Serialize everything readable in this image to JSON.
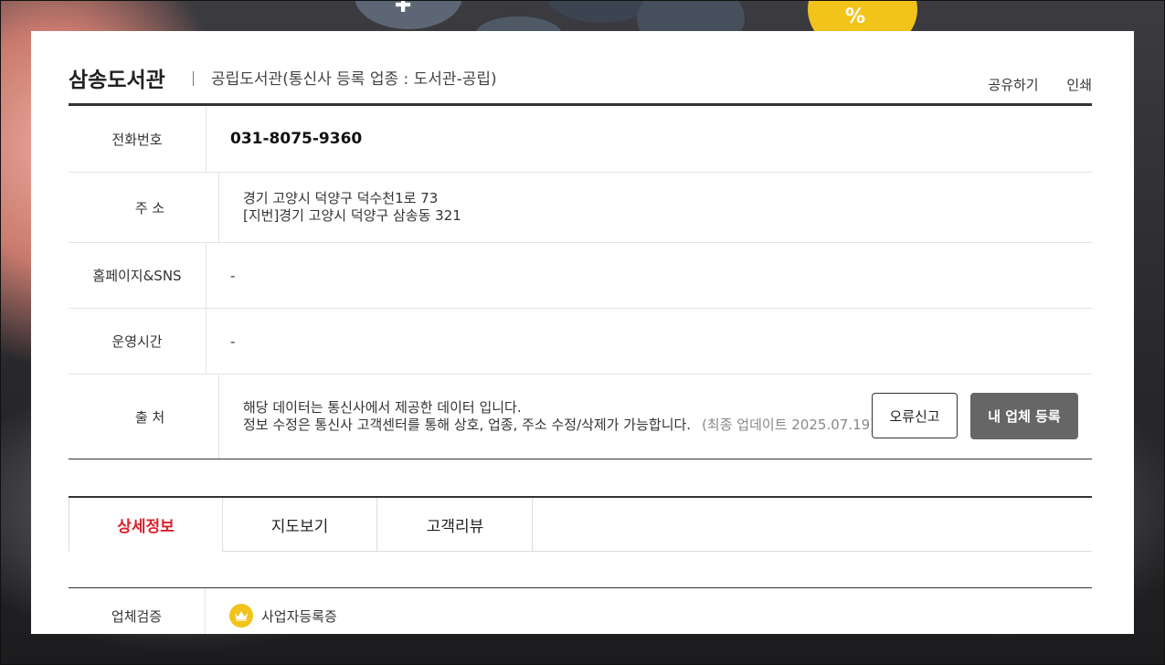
{
  "header": {
    "title": "삼송도서관",
    "subtitle": "공립도서관(통신사 등록 업종 : 도서관-공립)",
    "share_label": "공유하기",
    "print_label": "인쇄"
  },
  "info": {
    "phone_label": "전화번호",
    "phone_value": "031-8075-9360",
    "address_label": "주 소",
    "address_line1": "경기 고양시 덕양구 덕수천1로 73",
    "address_line2": "[지번]경기 고양시 덕양구 삼송동 321",
    "homepage_label": "홈페이지&SNS",
    "homepage_value": "-",
    "hours_label": "운영시간",
    "hours_value": "-",
    "source_label": "출 처",
    "source_line1": "해당 데이터는 통신사에서 제공한 데이터 입니다.",
    "source_line2": "정보 수정은 통신사 고객센터를 통해 상호, 업종, 주소 수정/삭제가 가능합니다.",
    "source_updated": "(최종 업데이트 2025.07.19)",
    "report_button": "오류신고",
    "register_button": "내 업체 등록"
  },
  "tabs": [
    {
      "label": "상세정보",
      "active": true
    },
    {
      "label": "지도보기",
      "active": false
    },
    {
      "label": "고객리뷰",
      "active": false
    }
  ],
  "verification": {
    "label": "업체검증",
    "value": "사업자등록증",
    "icon": "crown-icon"
  },
  "colors": {
    "accent_red": "#d8232a",
    "button_gray": "#666666",
    "badge_yellow": "#f2c31a"
  }
}
